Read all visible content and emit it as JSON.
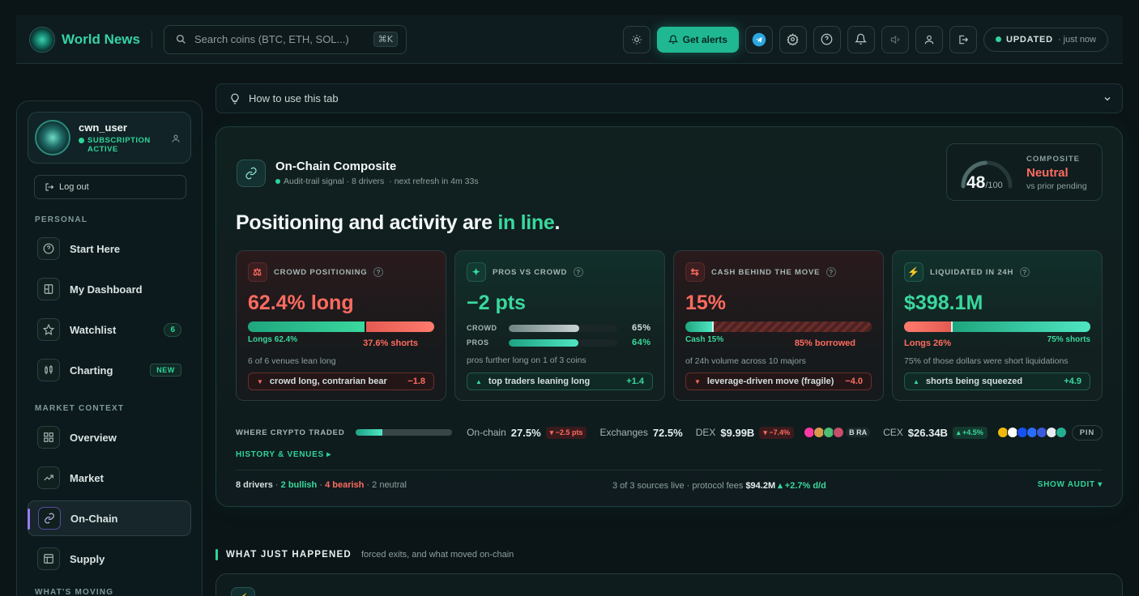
{
  "header": {
    "brand": "World News",
    "search_placeholder": "Search coins (BTC, ETH, SOL...)",
    "search_shortcut": "⌘K",
    "alerts_label": "Get alerts",
    "status_label": "UPDATED",
    "status_time": "· just now"
  },
  "sidebar": {
    "username": "cwn_user",
    "subscription_line1": "SUBSCRIPTION",
    "subscription_line2": "ACTIVE",
    "logout_label": "Log out",
    "sections": {
      "personal": "PERSONAL",
      "market_context": "MARKET CONTEXT",
      "whats_moving": "WHAT'S MOVING"
    },
    "items": [
      {
        "label": "Start Here",
        "icon": "help-circle-icon"
      },
      {
        "label": "My Dashboard",
        "icon": "dashboard-icon"
      },
      {
        "label": "Watchlist",
        "icon": "star-icon",
        "badge": "6"
      },
      {
        "label": "Charting",
        "icon": "candlestick-icon",
        "badge": "NEW"
      },
      {
        "label": "Overview",
        "icon": "grid-icon"
      },
      {
        "label": "Market",
        "icon": "trend-up-icon"
      },
      {
        "label": "On-Chain",
        "icon": "link-icon",
        "active": true
      },
      {
        "label": "Supply",
        "icon": "layout-icon"
      }
    ]
  },
  "howto": {
    "label": "How to use this tab"
  },
  "panel": {
    "title": "On-Chain Composite",
    "subtitle_a": "Audit-trail signal · 8 drivers",
    "subtitle_b": "· next refresh in 4m 33s",
    "composite": {
      "score": "48",
      "max": "/100",
      "score_value": 48,
      "label": "COMPOSITE",
      "state": "Neutral",
      "note": "vs prior pending"
    },
    "headline_a": "Positioning and activity are ",
    "headline_b": "in line",
    "headline_c": ".",
    "cards": {
      "crowd": {
        "title": "CROWD POSITIONING",
        "value": "62.4% long",
        "long_fraction": 0.624,
        "left_label": "Longs 62.4%",
        "right_label": "37.6% shorts",
        "note": "6 of 6 venues lean long",
        "pill": "crowd long, contrarian bear",
        "pill_value": "−1.8"
      },
      "pros": {
        "title": "PROS VS CROWD",
        "value": "−2 pts",
        "crowd_label": "CROWD",
        "crowd_value": "65%",
        "crowd_fraction": 0.65,
        "pros_label": "PROS",
        "pros_value": "64%",
        "pros_fraction": 0.64,
        "note": "pros further long on 1 of 3 coins",
        "pill": "top traders leaning long",
        "pill_value": "+1.4"
      },
      "cash": {
        "title": "CASH BEHIND THE MOVE",
        "value": "15%",
        "cash_fraction": 0.15,
        "left_label": "Cash 15%",
        "right_label": "85% borrowed",
        "note": "of 24h volume across 10 majors",
        "pill": "leverage-driven move (fragile)",
        "pill_value": "−4.0"
      },
      "liquidated": {
        "title": "LIQUIDATED IN 24H",
        "value": "$398.1M",
        "long_fraction": 0.26,
        "left_label": "Longs 26%",
        "right_label": "75% shorts",
        "note": "75% of those dollars were short liquidations",
        "pill": "shorts being squeezed",
        "pill_value": "+4.9"
      }
    },
    "traded": {
      "label": "WHERE CRYPTO TRADED",
      "onchain_fraction": 0.275,
      "onchain_label": "On-chain",
      "onchain_value": "27.5%",
      "onchain_change": "▾ −2.5 pts",
      "exchanges_label": "Exchanges",
      "exchanges_value": "72.5%",
      "dex_label": "DEX",
      "dex_value": "$9.99B",
      "dex_change": "▾ −7.4%",
      "dex_more": "B RA",
      "cex_label": "CEX",
      "cex_value": "$26.34B",
      "cex_change": "▴ +4.5%",
      "pin": "PIN"
    },
    "history_link": "HISTORY & VENUES ▸",
    "footer": {
      "drivers": "8 drivers",
      "sep1": " · ",
      "bullish": "2 bullish",
      "sep2": " · ",
      "bearish": "4 bearish",
      "neutral": " · 2 neutral",
      "sources": "3 of 3 sources live · protocol fees ",
      "fees": "$94.2M",
      "fees_change": " ▴ +2.7% d/d",
      "audit": "SHOW AUDIT ▾"
    }
  },
  "section2": {
    "title": "WHAT JUST HAPPENED",
    "subtitle": "forced exits, and what moved on-chain"
  },
  "colors": {
    "accent": "#2fd49a",
    "bull": "#3ad89e",
    "bear": "#ff6b5f",
    "active_marker": "#9b7bf0"
  }
}
